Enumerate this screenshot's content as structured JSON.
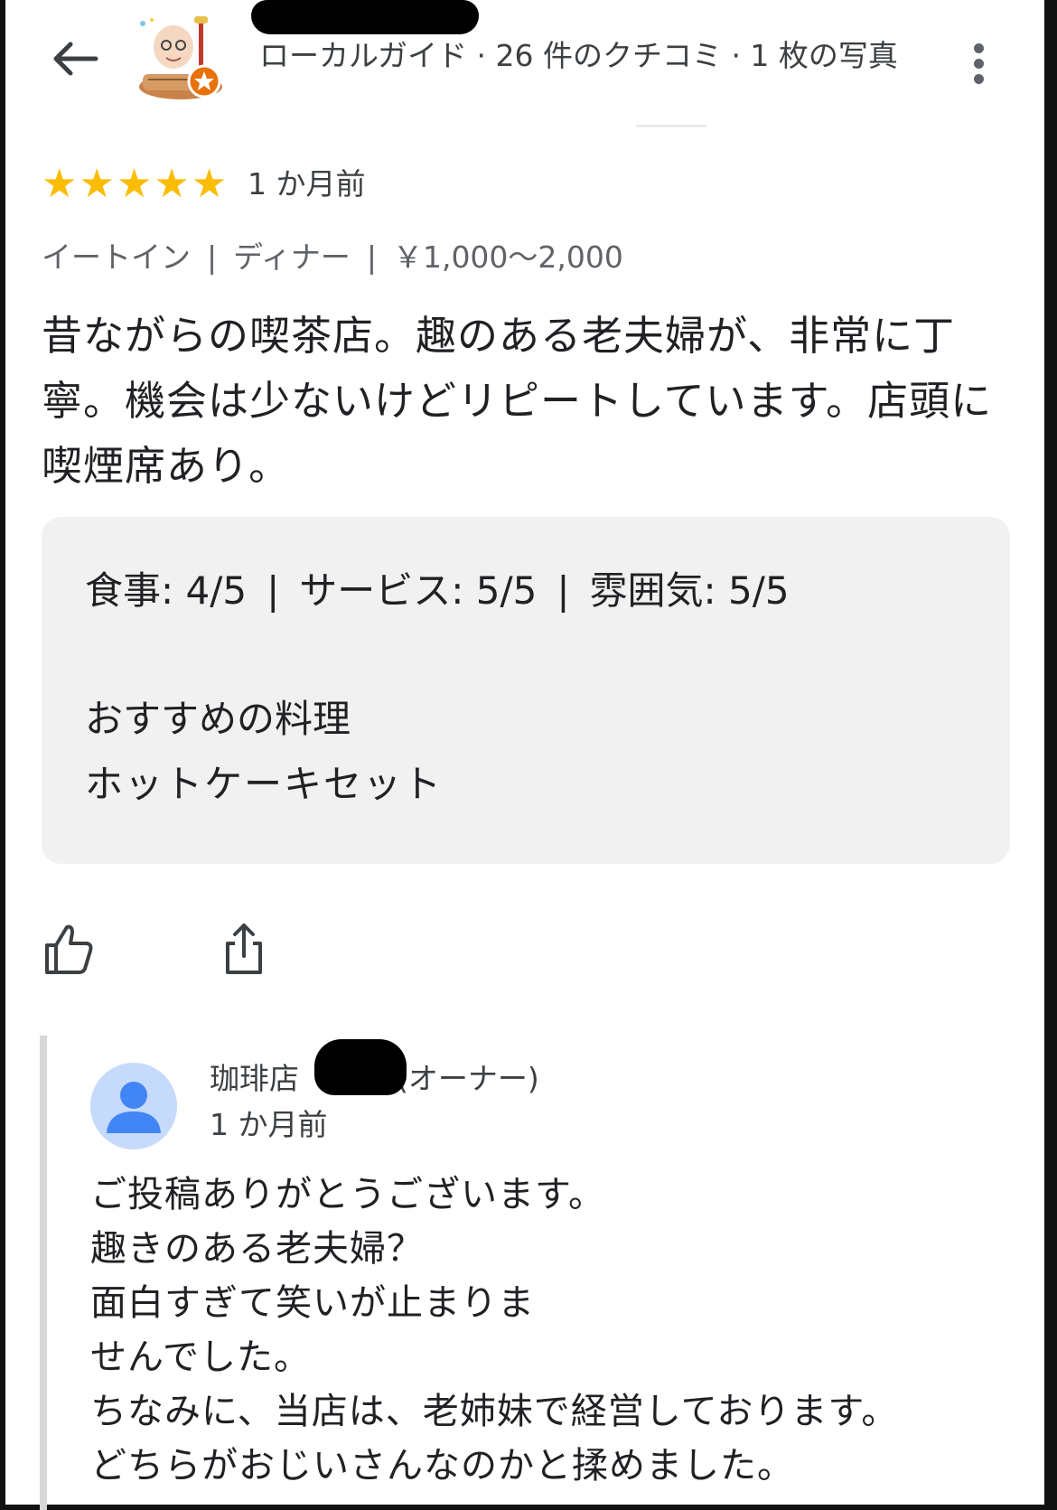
{
  "header": {
    "reviewer_meta": "ローカルガイド · 26 件のクチコミ · 1 枚の写真",
    "back_icon": "back-arrow-icon",
    "more_icon": "more-vert-icon"
  },
  "review": {
    "rating": 5,
    "rating_max": 5,
    "time_ago": "1 か月前",
    "tags": [
      "イートイン",
      "ディナー",
      "￥1,000～2,000"
    ],
    "text": "昔ながらの喫茶店。趣のある老夫婦が、非常に丁寧。機会は少ないけどリピートしています。店頭に喫煙席あり。"
  },
  "details": {
    "scores": [
      "食事: 4/5",
      "サービス: 5/5",
      "雰囲気: 5/5"
    ],
    "recommended_title": "おすすめの料理",
    "recommended_dish": "ホットケーキセット"
  },
  "actions": {
    "like_icon": "thumbs-up-icon",
    "share_icon": "share-icon"
  },
  "owner_reply": {
    "name_prefix": "珈琲店",
    "name_suffix": "(オーナー)",
    "time_ago": "1 か月前",
    "lines": [
      "ご投稿ありがとうございます。",
      "趣きのある老夫婦？",
      "面白すぎて笑いが止まりま",
      "せんでした。",
      "ちなみに、当店は、老姉妹で経営しております。",
      "どちらがおじいさんなのかと揉めました。"
    ]
  },
  "colors": {
    "star": "#fbbc04",
    "card_bg": "#f1f1f1",
    "avatar_blue": "#4285f4",
    "avatar_bg": "#c6dafc"
  }
}
